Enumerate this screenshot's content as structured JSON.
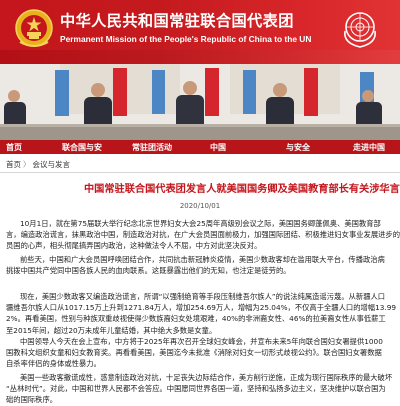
{
  "header": {
    "title_cn": "中华人民共和国常驻联合国代表团",
    "title_en": "Permanent Mission of the People's Republic of China to the UN",
    "brand_color": "#c4161c",
    "left_emblem": "national-emblem-icon",
    "right_emblem": "un-emblem-icon"
  },
  "nav": {
    "items": [
      "首页",
      "联合国与安",
      "常驻团活动",
      "中国",
      "与安全",
      "走进中国"
    ]
  },
  "breadcrumb": {
    "home": "首页",
    "separator": "〉",
    "section": "会议与发言"
  },
  "article": {
    "title": "中国常驻联合国代表团发言人就美国国务卿及美国教育部长有关涉华言论发",
    "date": "2020/10/01",
    "paragraphs": [
      [
        "10月1日，就在第75届联大举行纪念北京世界妇女大会25周年高级别会议之际，美国国务卿蓬佩奥、美国教育部",
        "言，编造政治谎言，抹黑政治中国，制造政治对抗，在广大会员国面前极力，加强国际团结、积极推进妇女事业发展进步的",
        "员国的心声，相头彻尾搞弄国内政治，这种做法令人不屈，中方对此坚决反对。"
      ],
      [
        "前些天，中国和广大会员国呼唤团结合作，共同抗击新冠肺炎疫情，美国少数政客却在滥用联大平台，传播政治病",
        "挑拨中国共产党同中国各族人民的血肉联系。这既暴露出他们的无知，也注定是徒劳的。"
      ],
      [
        "现在，美国少数政客又编造政治谎言，所谓“以强制绝育等手段压制维吾尔族人”的说法纯属造谣污蔑。从新疆人口",
        "疆维吾尔族人口从1017.15万上升到1271.84万人，增加254.69万人，增幅为25.04%，不仅高于全疆人口的增幅13.99",
        "2%。再看美国，性别与种族双重歧视使得少数族裔妇女处境艰难，40%的非洲裔女性、46%的拉美裔女性从事低薪工",
        "至2015年间，超过20万未成年儿童结婚，其中绝大多数是女童。"
      ],
      [
        "中国领导人今天在会上宣布，中方将于2025年再次召开全球妇女峰会，并宣布未来5年向联合国妇女署提供1000",
        "国教科文组织女童和妇女教育奖。再看看美国，美国迄今未批准《消除对妇女一切形式歧视公约》。联合国妇女署数据",
        "自杀率伴侣的身体或性暴力。"
      ],
      [
        "美国一些政客撒谎成性，惑意制造政治对抗，十足丧失边际结合作，美方削行逆施，正成为现行国际秩序的最大破坏",
        "“丛林时代”。对此，中国和世界人民都不会答应。中国愿同世界各国一道，坚持和弘扬多边主义，坚决维护以联合国为",
        "础的国际秩序。"
      ]
    ]
  }
}
